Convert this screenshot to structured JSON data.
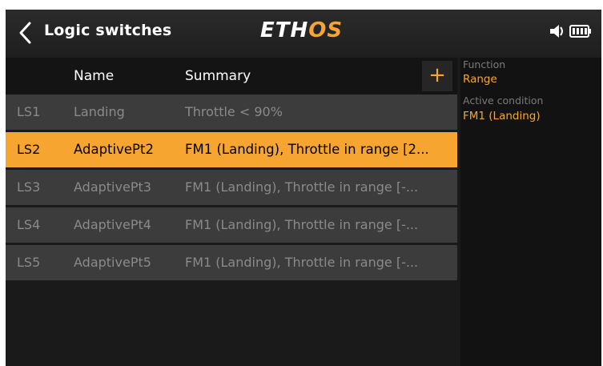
{
  "header": {
    "title": "Logic switches",
    "logo_main": "ETH",
    "logo_accent": "OS"
  },
  "list": {
    "col_name": "Name",
    "col_summary": "Summary",
    "add_label": "+",
    "rows": [
      {
        "id": "LS1",
        "name": "Landing",
        "summary": "Throttle < 90%"
      },
      {
        "id": "LS2",
        "name": "AdaptivePt2",
        "summary": "FM1 (Landing), Throttle in range [2..."
      },
      {
        "id": "LS3",
        "name": "AdaptivePt3",
        "summary": "FM1 (Landing), Throttle in range [-..."
      },
      {
        "id": "LS4",
        "name": "AdaptivePt4",
        "summary": "FM1 (Landing), Throttle in range [-..."
      },
      {
        "id": "LS5",
        "name": "AdaptivePt5",
        "summary": "FM1 (Landing), Throttle in range [-..."
      }
    ]
  },
  "details": {
    "function_label": "Function",
    "function_value": "Range",
    "active_condition_label": "Active condition",
    "active_condition_value": "FM1 (Landing)"
  },
  "colors": {
    "accent": "#f7a531",
    "background": "#1a1a1a",
    "row": "#3c3c3c"
  },
  "icons": [
    "chevron-left-icon",
    "speaker-icon",
    "battery-icon"
  ]
}
